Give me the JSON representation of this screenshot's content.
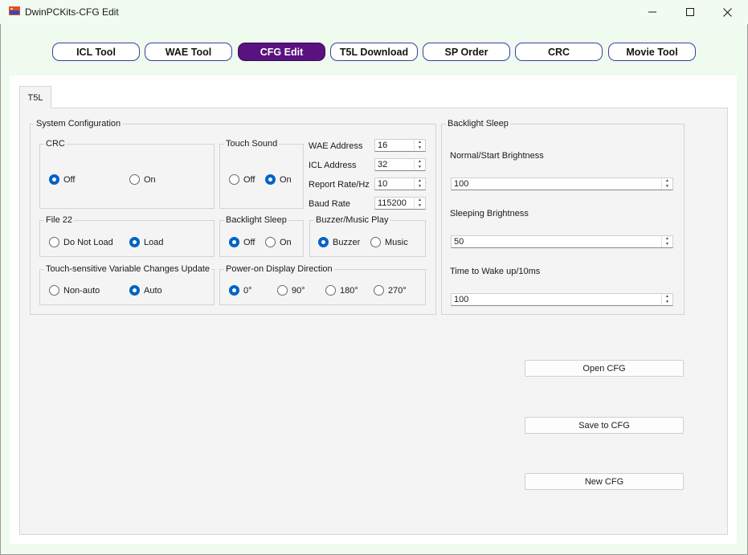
{
  "window": {
    "title": "DwinPCKits-CFG Edit",
    "icon": "dwin-app-icon",
    "controls": [
      "minimize-icon",
      "maximize-icon",
      "close-icon"
    ]
  },
  "nav": {
    "items": [
      "ICL Tool",
      "WAE Tool",
      "CFG Edit",
      "T5L Download",
      "SP Order",
      "CRC",
      "Movie Tool"
    ],
    "active": "CFG Edit",
    "active_color": "#5a1280"
  },
  "tab": {
    "label": "T5L"
  },
  "system": {
    "title": "System Configuration",
    "crc": {
      "title": "CRC",
      "off": "Off",
      "on": "On",
      "selected": "Off"
    },
    "touch_sound": {
      "title": "Touch Sound",
      "off": "Off",
      "on": "On",
      "selected": "On"
    },
    "wae_address": {
      "label": "WAE Address",
      "value": "16"
    },
    "icl_address": {
      "label": "ICL Address",
      "value": "32"
    },
    "report_rate": {
      "label": "Report Rate/Hz",
      "value": "10"
    },
    "baud_rate": {
      "label": "Baud Rate",
      "value": "115200"
    },
    "file22": {
      "title": "File 22",
      "opt1": "Do Not Load",
      "opt2": "Load",
      "selected": "Load"
    },
    "backlight_sleep": {
      "title": "Backlight Sleep",
      "off": "Off",
      "on": "On",
      "selected": "Off"
    },
    "buzzer": {
      "title": "Buzzer/Music Play",
      "opt1": "Buzzer",
      "opt2": "Music",
      "selected": "Buzzer"
    },
    "touch_update": {
      "title": "Touch-sensitive Variable Changes Update",
      "opt1": "Non-auto",
      "opt2": "Auto",
      "selected": "Auto"
    },
    "direction": {
      "title": "Power-on Display Direction",
      "options": [
        "0°",
        "90°",
        "180°",
        "270°"
      ],
      "selected": "0°"
    }
  },
  "backlight": {
    "title": "Backlight Sleep",
    "normal": {
      "label": "Normal/Start Brightness",
      "value": "100"
    },
    "sleeping": {
      "label": "Sleeping Brightness",
      "value": "50"
    },
    "wake": {
      "label": "Time to Wake up/10ms",
      "value": "100"
    }
  },
  "actions": {
    "open": "Open CFG",
    "save": "Save to CFG",
    "new": "New CFG"
  },
  "colors": {
    "radio_checked": "#0063c7",
    "background": "#eefbee"
  }
}
